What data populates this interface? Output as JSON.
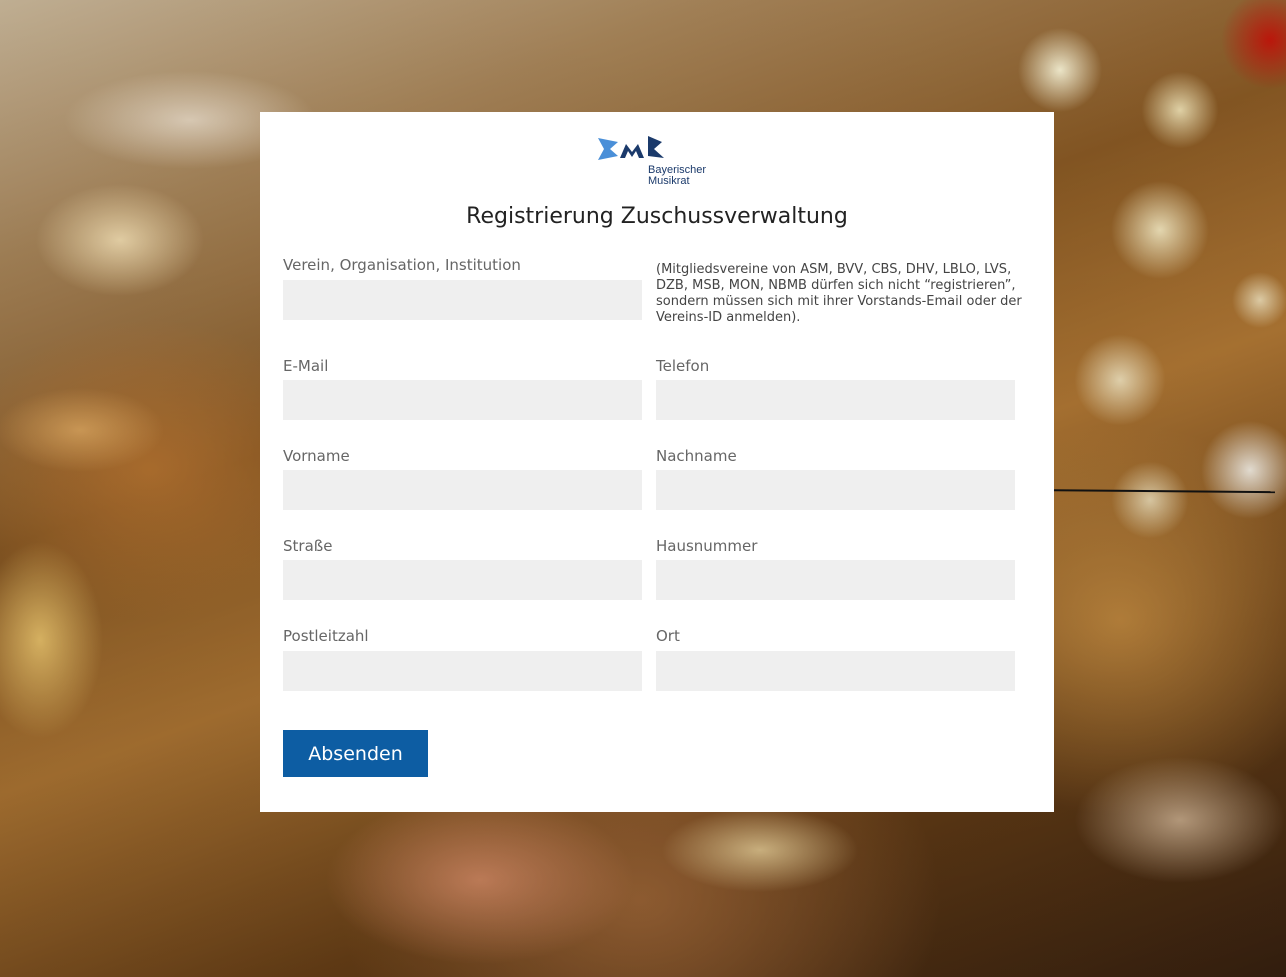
{
  "logo": {
    "line1": "Bayerischer",
    "line2": "Musikrat",
    "color_dark": "#1b3a6b",
    "color_light": "#4a8fd8"
  },
  "form": {
    "title": "Registrierung Zuschussverwaltung",
    "note": "(Mitgliedsvereine von ASM, BVV, CBS, DHV, LBLO, LVS, DZB, MSB, MON, NBMB dürfen sich nicht “registrieren”, sondern müssen sich mit ihrer Vorstands-Email oder der Vereins-ID anmelden).",
    "fields": {
      "organisation": {
        "label": "Verein, Organisation, Institution",
        "value": ""
      },
      "email": {
        "label": "E-Mail",
        "value": ""
      },
      "telefon": {
        "label": "Telefon",
        "value": ""
      },
      "vorname": {
        "label": "Vorname",
        "value": ""
      },
      "nachname": {
        "label": "Nachname",
        "value": ""
      },
      "strasse": {
        "label": "Straße",
        "value": ""
      },
      "hausnummer": {
        "label": "Hausnummer",
        "value": ""
      },
      "plz": {
        "label": "Postleitzahl",
        "value": ""
      },
      "ort": {
        "label": "Ort",
        "value": ""
      }
    },
    "submit_label": "Absenden"
  },
  "colors": {
    "button": "#0d5da3",
    "field_bg": "#efefef"
  }
}
